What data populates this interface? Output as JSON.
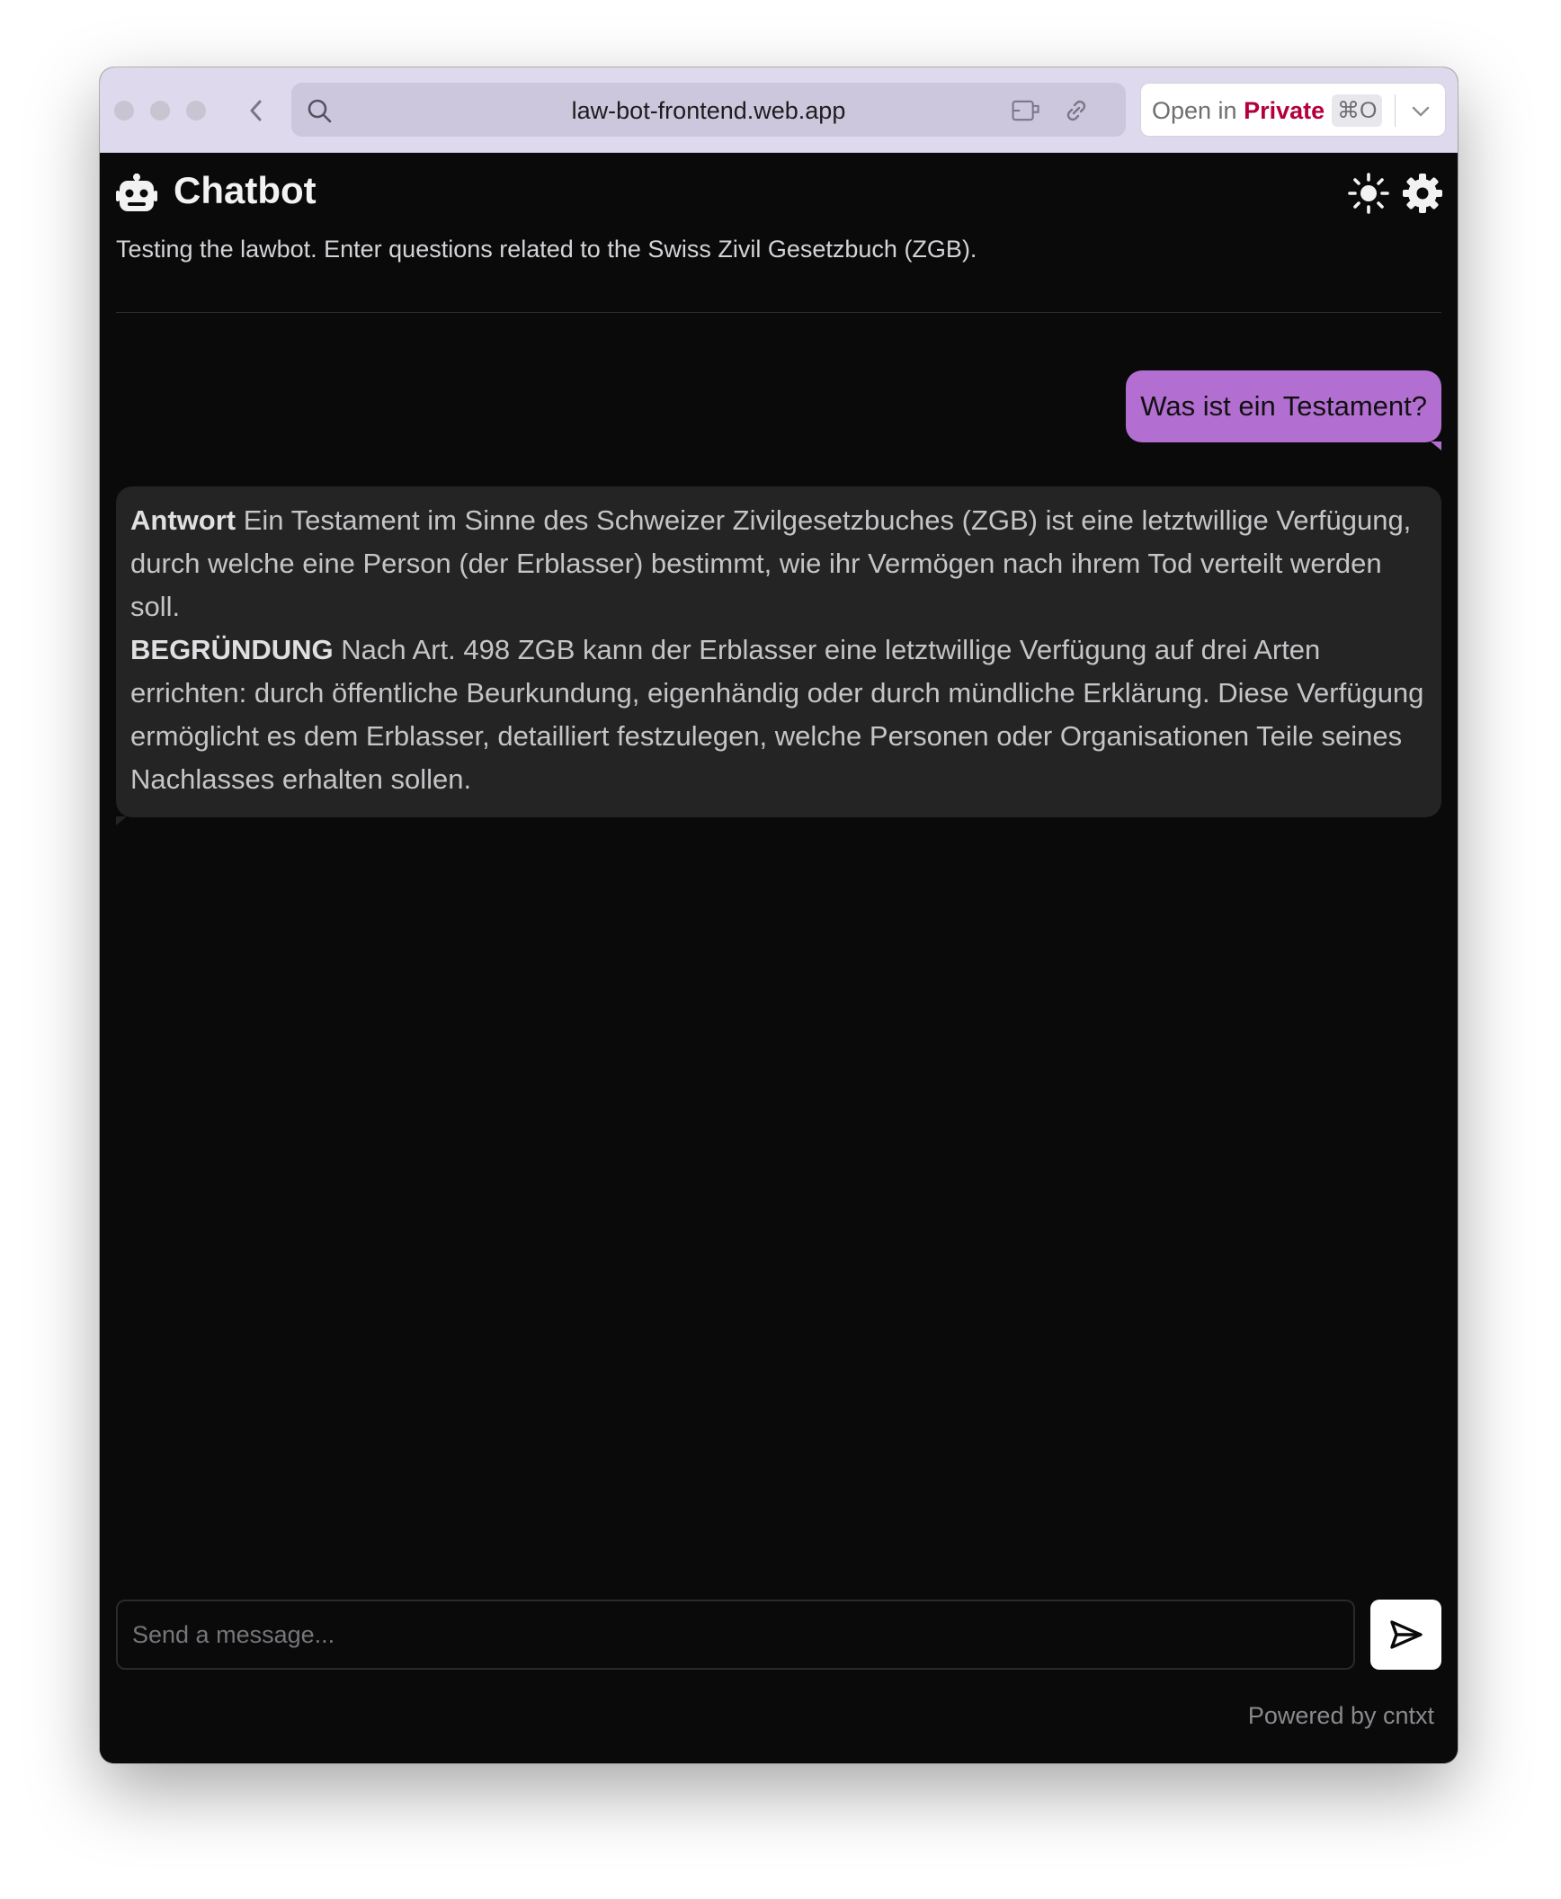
{
  "browser": {
    "url": "law-bot-frontend.web.app",
    "private_prefix": "Open in",
    "private_word": "Private",
    "shortcut": "⌘O"
  },
  "header": {
    "title": "Chatbot",
    "subtitle": "Testing the lawbot. Enter questions related to the Swiss Zivil Gesetzbuch (ZGB)."
  },
  "messages": {
    "user": "Was ist ein Testament?",
    "bot": {
      "answer_label": "Antwort",
      "answer_text": "Ein Testament im Sinne des Schweizer Zivilgesetzbuches (ZGB) ist eine letztwillige Verfügung, durch welche eine Person (der Erblasser) bestimmt, wie ihr Vermögen nach ihrem Tod verteilt werden soll.",
      "reason_label": "BEGRÜNDUNG",
      "reason_text": "Nach Art. 498 ZGB kann der Erblasser eine letztwillige Verfügung auf drei Arten errichten: durch öffentliche Beurkundung, eigenhändig oder durch mündliche Erklärung. Diese Verfügung ermöglicht es dem Erblasser, detailliert festzulegen, welche Personen oder Organisationen Teile seines Nachlasses erhalten sollen."
    }
  },
  "composer": {
    "placeholder": "Send a message...",
    "value": ""
  },
  "footer": {
    "text": "Powered by cntxt"
  },
  "colors": {
    "user_bubble": "#b26ed1",
    "bot_bubble": "#242424",
    "background": "#0a0a0a",
    "private_accent": "#b3003a"
  },
  "icons": {
    "header": "robot-icon",
    "theme": "sun-icon",
    "settings": "gear-icon",
    "send": "send-icon"
  }
}
